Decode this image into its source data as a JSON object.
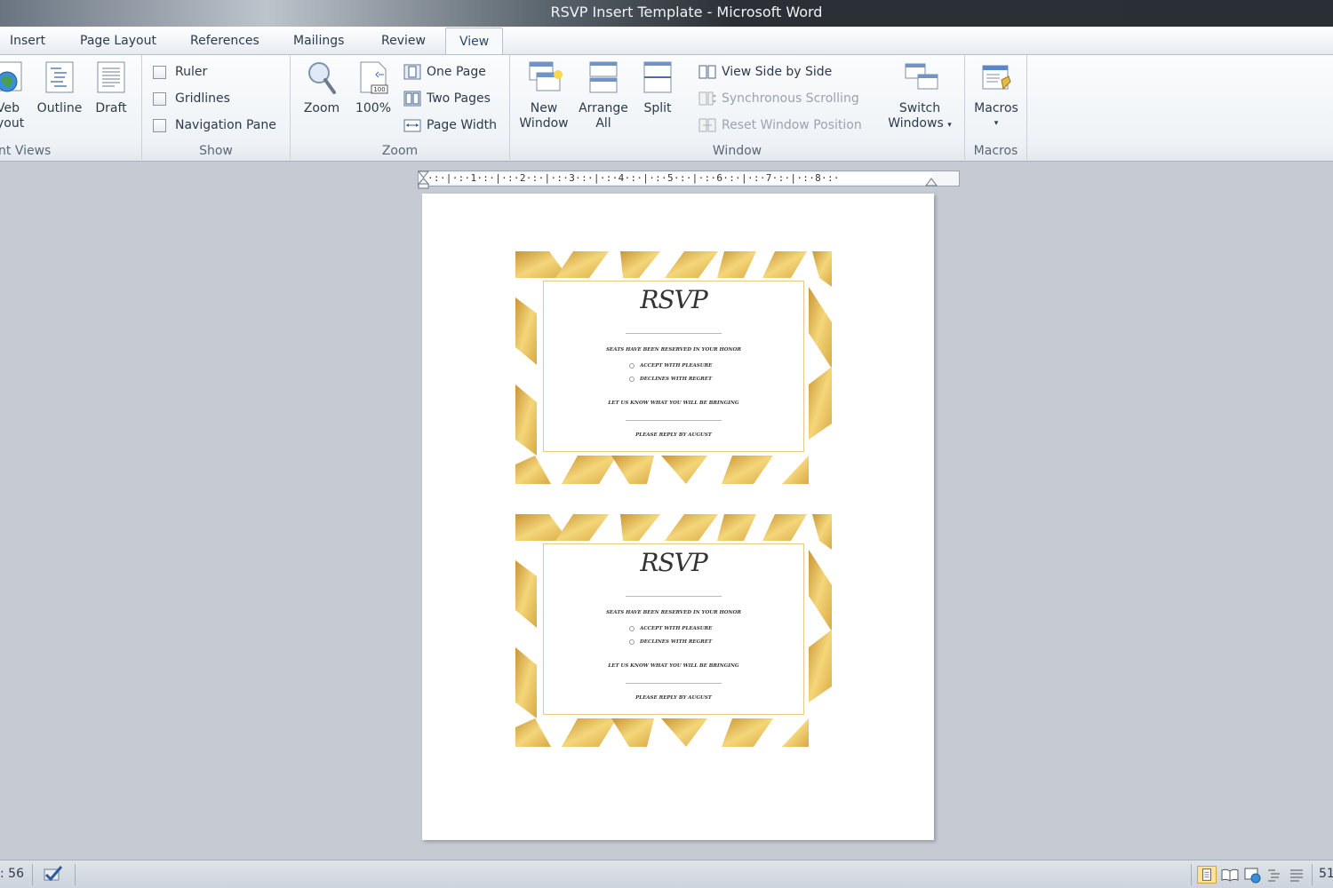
{
  "window": {
    "title": "RSVP Insert Template  -  Microsoft Word"
  },
  "tabs": [
    {
      "label": "Insert",
      "active": false
    },
    {
      "label": "Page Layout",
      "active": false
    },
    {
      "label": "References",
      "active": false
    },
    {
      "label": "Mailings",
      "active": false
    },
    {
      "label": "Review",
      "active": false
    },
    {
      "label": "View",
      "active": true
    }
  ],
  "ribbon": {
    "views": {
      "label": "nt Views",
      "web_layout_1": "Veb",
      "web_layout_2": "yout",
      "outline": "Outline",
      "draft": "Draft"
    },
    "show": {
      "label": "Show",
      "ruler": "Ruler",
      "gridlines": "Gridlines",
      "navigation_pane": "Navigation Pane"
    },
    "zoom": {
      "label": "Zoom",
      "zoom": "Zoom",
      "hundred": "100%",
      "one_page": "One Page",
      "two_pages": "Two Pages",
      "page_width": "Page Width"
    },
    "window": {
      "label": "Window",
      "new_window_1": "New",
      "new_window_2": "Window",
      "arrange_all_1": "Arrange",
      "arrange_all_2": "All",
      "split": "Split",
      "view_side_by_side": "View Side by Side",
      "synchronous_scrolling": "Synchronous Scrolling",
      "reset_window_position": "Reset Window Position",
      "switch_windows_1": "Switch",
      "switch_windows_2": "Windows"
    },
    "macros": {
      "label": "Macros",
      "macros": "Macros"
    }
  },
  "ruler": {
    "marks": "·:·|·:·1·:·|·:·2·:·|·:·3·:·|·:·4·:·|·:·5·:·|·:·6·:·|·:·7·:·|·:·8·:·"
  },
  "document": {
    "cards": [
      {
        "title": "RSVP",
        "line1": "SEATS HAVE BEEN RESERVED IN YOUR HONOR",
        "option1": "ACCEPT WITH PLEASURE",
        "option2": "DECLINES WITH REGRET",
        "line2": "LET US KNOW WHAT YOU WILL BE BRINGING",
        "line3": "PLEASE REPLY BY AUGUST"
      },
      {
        "title": "RSVP",
        "line1": "SEATS HAVE BEEN RESERVED IN YOUR HONOR",
        "option1": "ACCEPT WITH PLEASURE",
        "option2": "DECLINES WITH REGRET",
        "line2": "LET US KNOW WHAT YOU WILL BE BRINGING",
        "line3": "PLEASE REPLY BY AUGUST"
      }
    ]
  },
  "status": {
    "word_count": ": 56",
    "zoom_level": "51"
  },
  "colors": {
    "gold": "#d9a944",
    "accent_blue": "#2b579a"
  }
}
